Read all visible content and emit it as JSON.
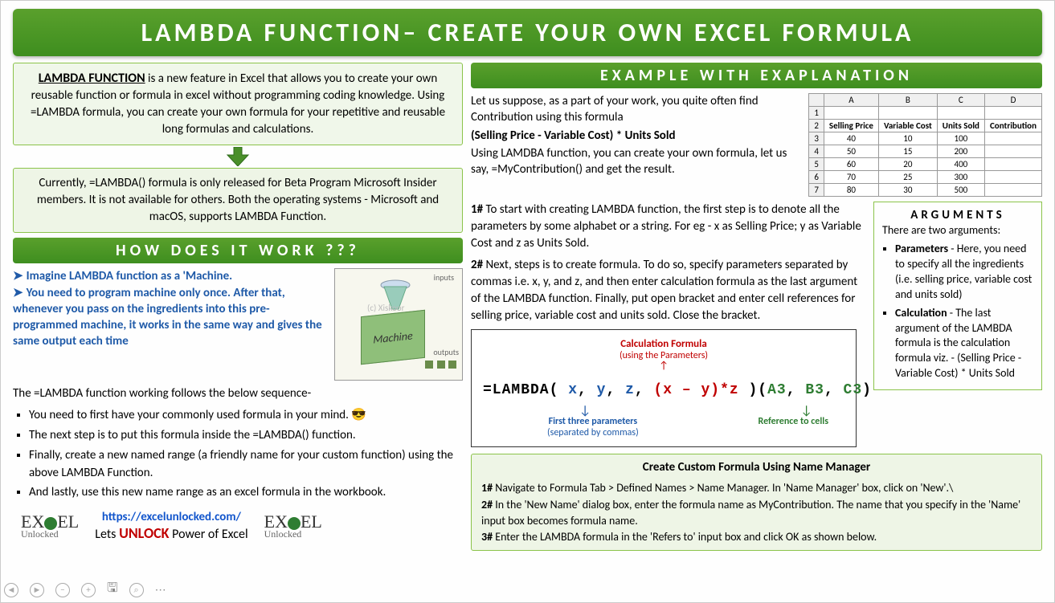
{
  "title": "LAMBDA FUNCTION– CREATE YOUR OWN EXCEL FORMULA",
  "intro": {
    "lead": "LAMBDA FUNCTION",
    "body": " is a new feature in Excel that allows you to create your own reusable function or formula in excel without programming coding knowledge. Using =LAMBDA formula, you can create your own formula for your repetitive and reusable long formulas and calculations."
  },
  "beta_note": "Currently, =LAMBDA() formula is only released for Beta Program Microsoft Insider members. It is not available for others. Both the operating systems - Microsoft and macOS, supports LAMBDA Function.",
  "how_header": "HOW DOES IT WORK ???",
  "how_bullets": [
    "Imagine LAMBDA function as a 'Machine.",
    "You need to program machine only once. After that, whenever you pass on the ingredients into this pre-programmed machine, it works in the same way and gives the same output each time"
  ],
  "machine": {
    "label": "Machine",
    "inputs": "inputs",
    "outputs": "outputs",
    "watermark": "(c) Xiskoor"
  },
  "sequence_intro": "The =LAMBDA function working follows the below sequence-",
  "sequence": [
    "You need to first have your commonly used formula in your mind. 😎",
    "The next step is to put this formula inside the =LAMBDA() function.",
    "Finally, create a new named range (a friendly name for your custom function) using the above LAMBDA Function.",
    "And lastly, use this new name range as an excel formula in the workbook."
  ],
  "footer": {
    "logo_top": "EXCEL",
    "logo_bottom": "Unlocked",
    "url": "https://excelunlocked.com/",
    "slogan_pre": "Lets ",
    "slogan_mid": "UNLOCK",
    "slogan_post": " Power of Excel"
  },
  "example_header": "EXAMPLE WITH EXAPLANATION",
  "example": {
    "p1": "Let us suppose, as a part of your work, you quite often find Contribution using this formula",
    "formula_text": "(Selling Price - Variable Cost) * Units Sold",
    "p2": "Using LAMDBA function, you can create your own formula, let us say, =MyContribution() and get the result.",
    "step1_num": "1#",
    "step1": " To start with creating LAMBDA function, the first step is to denote all the parameters by some alphabet or a string. For eg - x as Selling Price; y as Variable Cost and z as Units Sold.",
    "step2_num": "2#",
    "step2": " Next, steps is to create formula. To do so, specify parameters separated by commas i.e. x, y, and z, and then enter calculation formula as the last argument of the LAMBDA function. Finally, put open bracket and enter cell references for selling price, variable cost and units sold. Close the bracket."
  },
  "table": {
    "cols": [
      "",
      "A",
      "B",
      "C",
      "D"
    ],
    "hdr": [
      "2",
      "Selling Price",
      "Variable Cost",
      "Units Sold",
      "Contribution"
    ],
    "rows": [
      [
        "3",
        "40",
        "10",
        "100",
        ""
      ],
      [
        "4",
        "50",
        "15",
        "200",
        ""
      ],
      [
        "5",
        "60",
        "20",
        "400",
        ""
      ],
      [
        "6",
        "70",
        "25",
        "300",
        ""
      ],
      [
        "7",
        "80",
        "30",
        "500",
        ""
      ]
    ],
    "row1": [
      "1",
      "",
      "",
      "",
      ""
    ]
  },
  "formula_diagram": {
    "calc_label": "Calculation Formula",
    "calc_sub": "(using the Parameters)",
    "text": "=LAMBDA( x, y, z, (x – y)*z )(A3, B3, C3)",
    "param_label": "First three parameters",
    "param_sub": "(separated by commas)",
    "ref_label": "Reference to cells"
  },
  "arguments": {
    "title": "ARGUMENTS",
    "intro": "There are two arguments:",
    "items": [
      {
        "name": "Parameters",
        "desc": " - Here, you need to specify all the ingredients (i.e. selling price, variable cost and units sold)"
      },
      {
        "name": "Calculation",
        "desc": " - The last argument of the LAMBDA formula is the calculation formula viz. - (Selling Price - Variable Cost) * Units Sold"
      }
    ]
  },
  "name_manager": {
    "title": "Create Custom Formula Using Name Manager",
    "steps": [
      {
        "num": "1#",
        "text": " Navigate to Formula Tab > Defined Names > Name Manager. In 'Name Manager' box, click on 'New'.\\"
      },
      {
        "num": "2#",
        "text": " In the 'New Name' dialog box, enter the formula name as MyContribution. The name that you specify in the 'Name' input box becomes formula name."
      },
      {
        "num": "3#",
        "text": " Enter the LAMBDA formula in the 'Refers to' input box and click OK as shown below."
      }
    ]
  }
}
